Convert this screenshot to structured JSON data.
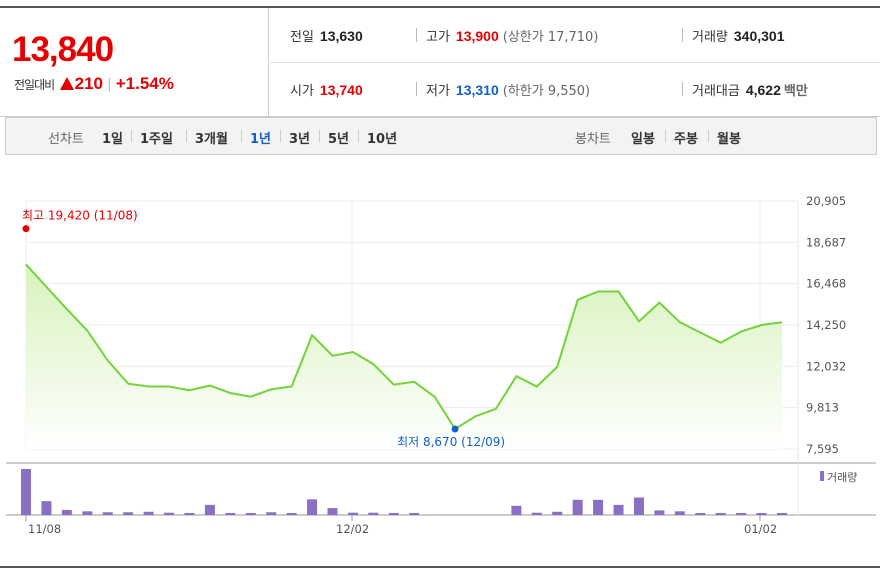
{
  "quote": {
    "price": "13,840",
    "change_label": "전일대비",
    "change_amount": "210",
    "change_pct": "+1.54%",
    "prev_label": "전일",
    "prev_value": "13,630",
    "high_label": "고가",
    "high_value": "13,900",
    "upper_limit": "(상한가 17,710)",
    "volume_label": "거래량",
    "volume_value": "340,301",
    "open_label": "시가",
    "open_value": "13,740",
    "low_label": "저가",
    "low_value": "13,310",
    "lower_limit": "(하한가 9,550)",
    "amount_label": "거래대금",
    "amount_value": "4,622",
    "amount_unit": "백만"
  },
  "toolbar": {
    "line_label": "선차트",
    "periods": [
      "1일",
      "1주일",
      "3개월",
      "1년",
      "3년",
      "5년",
      "10년"
    ],
    "active_period": "1년",
    "candle_label": "봉차트",
    "candles": [
      "일봉",
      "주봉",
      "월봉"
    ]
  },
  "chart_data": {
    "type": "area",
    "x_ticks": [
      "11/08",
      "12/02",
      "01/02"
    ],
    "y_ticks": [
      "20,905",
      "18,687",
      "16,468",
      "14,250",
      "12,032",
      "9,813",
      "7,595"
    ],
    "ylim": [
      7595,
      20905
    ],
    "values": [
      17500,
      16300,
      15100,
      13950,
      12350,
      11100,
      10950,
      10950,
      10750,
      11000,
      10600,
      10400,
      10800,
      10950,
      13700,
      12600,
      12800,
      12150,
      11050,
      11200,
      10400,
      8670,
      9350,
      9750,
      11500,
      10950,
      12000,
      15600,
      16050,
      16050,
      14450,
      15450,
      14400,
      13850,
      13300,
      13900,
      14250,
      14400
    ],
    "volume": [
      100,
      30,
      11,
      8,
      6,
      6,
      7,
      5,
      4,
      22,
      4,
      4,
      6,
      4,
      34,
      15,
      5,
      5,
      3,
      2,
      0,
      0,
      0,
      0,
      20,
      5,
      7,
      33,
      33,
      22,
      38,
      10,
      8,
      4,
      3,
      3,
      3,
      3
    ],
    "max_annotation": "최고 19,420 (11/08)",
    "min_annotation": "최저 8,670 (12/09)",
    "volume_legend": "거래량",
    "colors": {
      "line": "#73d33a",
      "area_top": "#ddf5c5",
      "volume": "#8a6fc4",
      "high": "#e60000",
      "low": "#1061c8"
    }
  }
}
